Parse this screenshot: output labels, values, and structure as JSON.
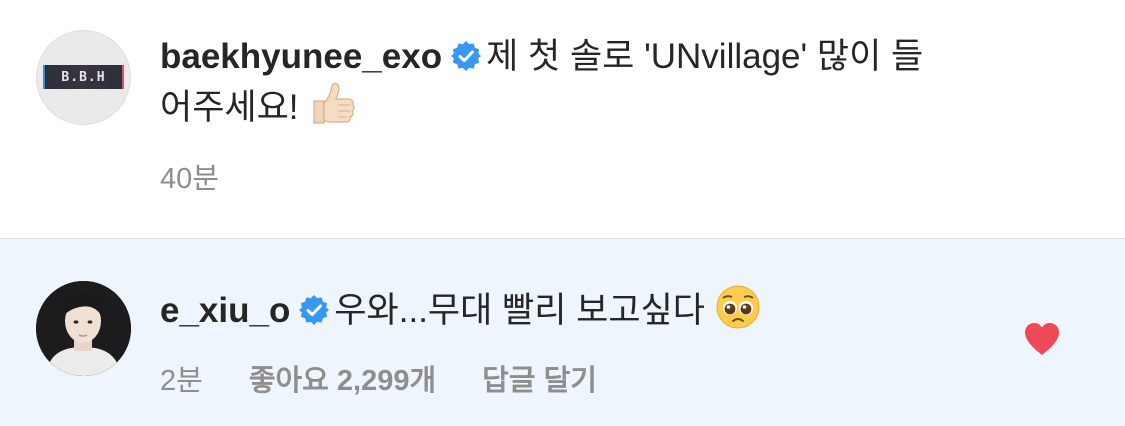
{
  "post": {
    "avatar_text": "B.B.H",
    "username": "baekhyunee_exo",
    "text_line1": "제 첫 솔로 'UNvillage' 많이 들",
    "text_line2": "어주세요!",
    "emoji": "thumbs-up-icon",
    "time": "40분"
  },
  "reply": {
    "username": "e_xiu_o",
    "text": "우와...무대 빨리 보고싶다",
    "emoji": "pleading-face-icon",
    "time": "2분",
    "likes": "좋아요 2,299개",
    "reply_button": "답글 달기",
    "heart_icon": "heart-icon",
    "liked": true
  },
  "colors": {
    "verified_blue": "#3897f0",
    "heart_red": "#ed4956",
    "reply_background": "#eff5fd",
    "meta_gray": "#8e8e8e"
  }
}
